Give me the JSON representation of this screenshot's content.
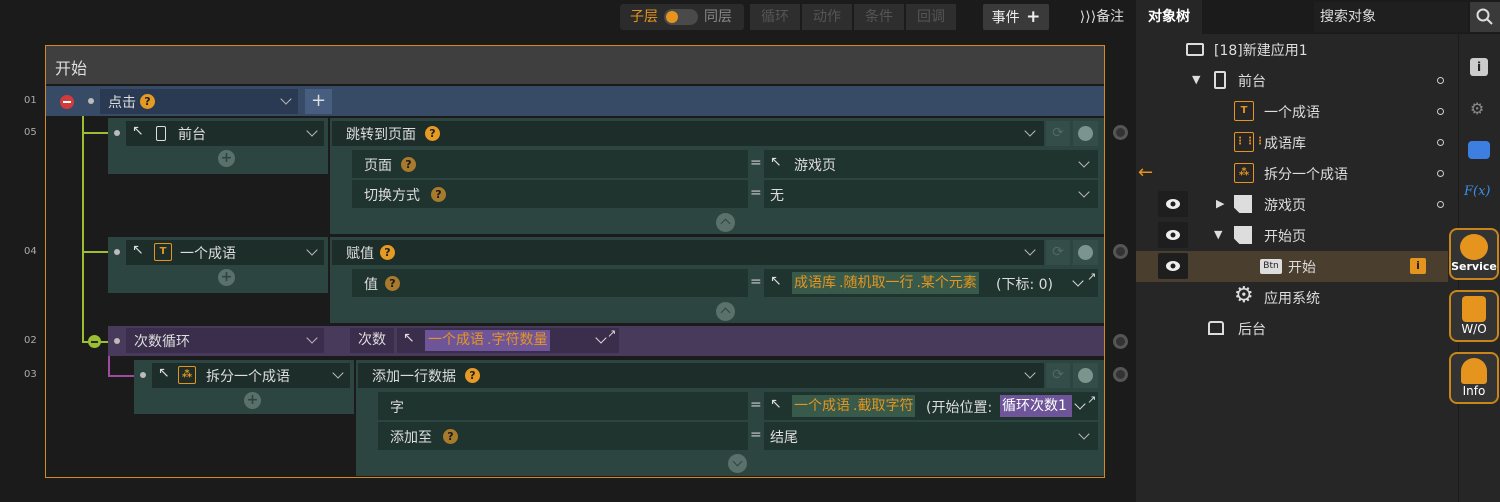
{
  "toolbar": {
    "child_layer": "子层",
    "same_layer": "同层",
    "loop": "循环",
    "action": "动作",
    "condition": "条件",
    "callback": "回调",
    "event": "事件",
    "notes": "备注"
  },
  "panel": {
    "title": "对象树",
    "search_placeholder": "搜索对象"
  },
  "editor": {
    "start_label": "开始"
  },
  "line_numbers": [
    "01",
    "05",
    "04",
    "02",
    "03"
  ],
  "row01": {
    "trigger": "点击"
  },
  "row05": {
    "target": "前台",
    "action": "跳转到页面",
    "param1_label": "页面",
    "param1_value": "游戏页",
    "param2_label": "切换方式",
    "param2_value": "无"
  },
  "row04": {
    "target": "一个成语",
    "action": "赋值",
    "param1_label": "值",
    "param1_value_obj": "成语库",
    "param1_value_p1": ".随机取一行",
    "param1_value_p2": ".某个元素",
    "param1_value_tail": "(下标: 0)"
  },
  "row02": {
    "target": "次数循环",
    "count_label": "次数",
    "count_obj": "一个成语",
    "count_prop": ".字符数量"
  },
  "row03": {
    "target": "拆分一个成语",
    "action": "添加一行数据",
    "param1_label": "字",
    "param1_value_obj": "一个成语",
    "param1_value_p1": ".截取字符",
    "param1_value_tail": "(开始位置:",
    "param1_value_chip": "循环次数1",
    "param2_label": "添加至",
    "param2_value": "结尾"
  },
  "tree": {
    "app": "[18]新建应用1",
    "front": "前台",
    "idiom": "一个成语",
    "idiom_lib": "成语库",
    "split": "拆分一个成语",
    "game_page": "游戏页",
    "start_page": "开始页",
    "start_btn": "开始",
    "app_system": "应用系统",
    "backend": "后台",
    "btn_tag": "Btn"
  },
  "side": {
    "service": "Service",
    "wo": "W/O",
    "info": "Info",
    "fx": "F(x)"
  },
  "colors": {
    "accent": "#e5951e",
    "purple": "#8a6fc0",
    "teal": "#2d4540"
  }
}
